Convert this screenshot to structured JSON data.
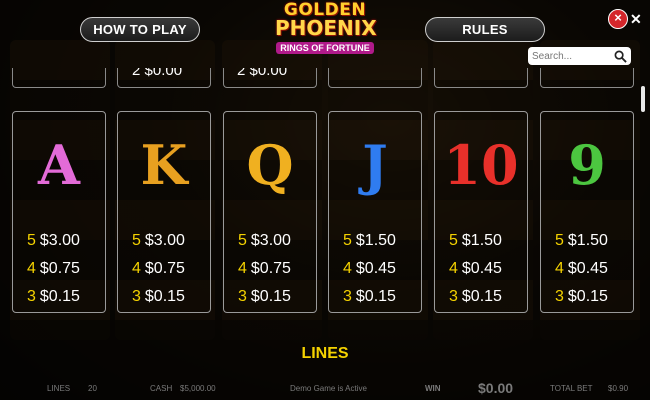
{
  "header": {
    "how_to_play": "HOW TO PLAY",
    "rules": "RULES",
    "logo": {
      "line1": "GOLDEN",
      "line2": "PHOENIX",
      "line3": "RINGS OF FORTUNE"
    },
    "close": "×",
    "search_placeholder": "Search..."
  },
  "partial_row": [
    "2 $0.00",
    "2 $0.00"
  ],
  "symbols": [
    {
      "symbol": "A",
      "color": "#e36bd8",
      "pays": [
        [
          "5",
          "$3.00"
        ],
        [
          "4",
          "$0.75"
        ],
        [
          "3",
          "$0.15"
        ]
      ]
    },
    {
      "symbol": "K",
      "color": "#e8a020",
      "pays": [
        [
          "5",
          "$3.00"
        ],
        [
          "4",
          "$0.75"
        ],
        [
          "3",
          "$0.15"
        ]
      ]
    },
    {
      "symbol": "Q",
      "color": "#f0b020",
      "pays": [
        [
          "5",
          "$3.00"
        ],
        [
          "4",
          "$0.75"
        ],
        [
          "3",
          "$0.15"
        ]
      ]
    },
    {
      "symbol": "J",
      "color": "#2f7cf0",
      "pays": [
        [
          "5",
          "$1.50"
        ],
        [
          "4",
          "$0.45"
        ],
        [
          "3",
          "$0.15"
        ]
      ]
    },
    {
      "symbol": "10",
      "color": "#e8302a",
      "pays": [
        [
          "5",
          "$1.50"
        ],
        [
          "4",
          "$0.45"
        ],
        [
          "3",
          "$0.15"
        ]
      ]
    },
    {
      "symbol": "9",
      "color": "#4cc640",
      "pays": [
        [
          "5",
          "$1.50"
        ],
        [
          "4",
          "$0.45"
        ],
        [
          "3",
          "$0.15"
        ]
      ]
    }
  ],
  "section_heading": "LINES",
  "bottom": {
    "lines_label": "LINES",
    "lines_value": "20",
    "cash_label": "CASH",
    "cash_value": "$5,000.00",
    "demo": "Demo Game is Active",
    "win_label": "WIN",
    "win_value": "$0.00",
    "total_bet_label": "TOTAL BET",
    "total_bet_value": "$0.90"
  }
}
